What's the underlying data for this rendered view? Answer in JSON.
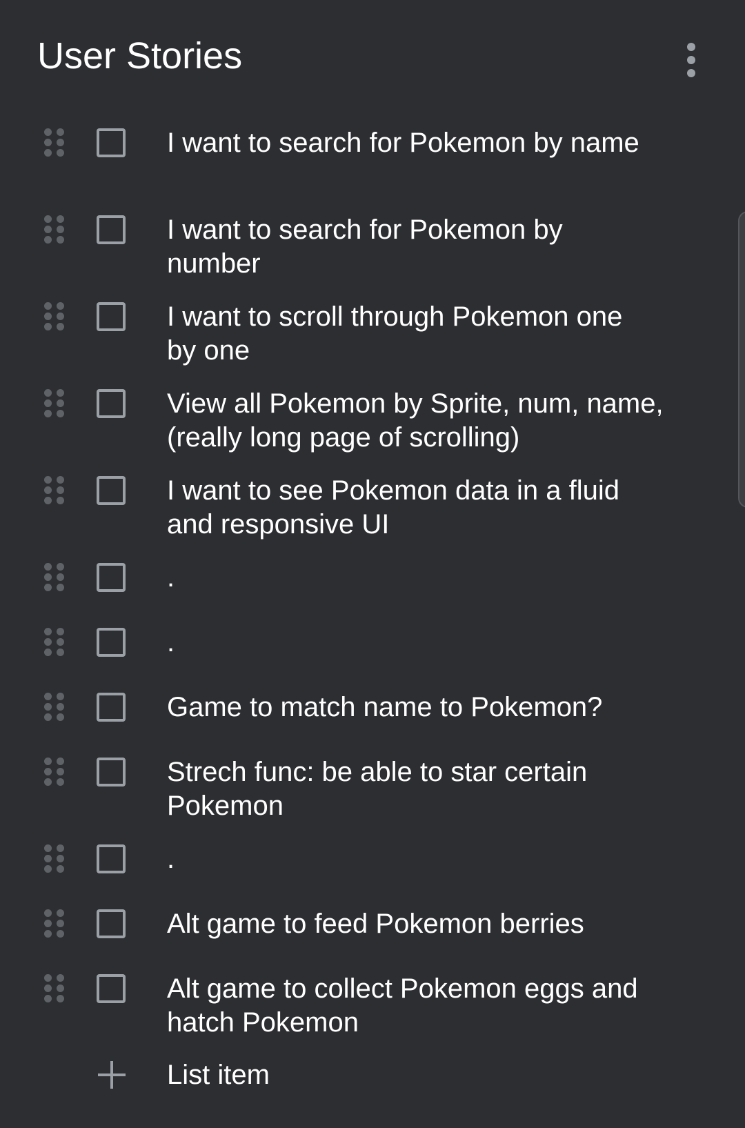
{
  "header": {
    "title": "User Stories",
    "menu_icon": "more-vert-icon"
  },
  "items": [
    {
      "text": "I want to search for Pokemon by name",
      "checked": false
    },
    {
      "text": "I want to search for Pokemon by number",
      "checked": false
    },
    {
      "text": "I want to scroll through Pokemon one by one",
      "checked": false
    },
    {
      "text": "View all Pokemon by Sprite, num, name, (really long page of scrolling)",
      "checked": false
    },
    {
      "text": "I want to see Pokemon data in a fluid and responsive UI",
      "checked": false
    },
    {
      "text": ".",
      "checked": false
    },
    {
      "text": ".",
      "checked": false
    },
    {
      "text": "Game to match name to Pokemon?",
      "checked": false
    },
    {
      "text": "Strech func: be able to star certain Pokemon",
      "checked": false
    },
    {
      "text": ".",
      "checked": false
    },
    {
      "text": "Alt game to feed Pokemon berries",
      "checked": false
    },
    {
      "text": "Alt game to collect Pokemon eggs and hatch Pokemon",
      "checked": false
    }
  ],
  "add_item": {
    "label": "List item",
    "icon": "plus-icon"
  },
  "colors": {
    "background": "#2d2e32",
    "text": "#ffffff",
    "checkbox_border": "#9aa0a6",
    "handle_dots": "#5f6368"
  }
}
